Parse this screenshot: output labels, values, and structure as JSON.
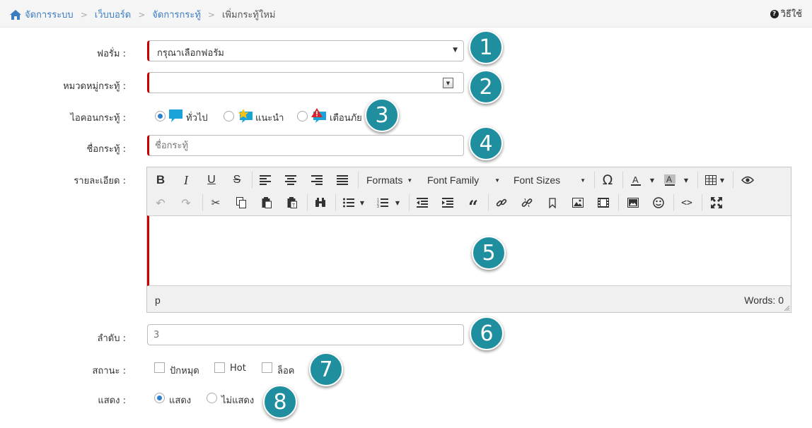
{
  "breadcrumb": {
    "items": [
      "จัดการระบบ",
      "เว็บบอร์ด",
      "จัดการกระทู้"
    ],
    "current": "เพิ่มกระทู้ใหม่"
  },
  "help": {
    "label": "วิธีใช้"
  },
  "form": {
    "forum_label": "ฟอรั่ม :",
    "forum_value": "กรุณาเลือกฟอรัม",
    "category_label": "หมวดหมู่กระทู้ :",
    "category_value": "",
    "icon_label": "ไอคอนกระทู้ :",
    "icon_options": [
      {
        "label": "ทั่วไป",
        "checked": true
      },
      {
        "label": "แนะนำ",
        "checked": false
      },
      {
        "label": "เตือนภัย",
        "checked": false
      }
    ],
    "title_label": "ชื่อกระทู้ :",
    "title_placeholder": "ชื่อกระทู้",
    "detail_label": "รายละเอียด :",
    "order_label": "ลำดับ :",
    "order_placeholder": "3",
    "status_label": "สถานะ :",
    "status_options": [
      {
        "label": "ปักหมุด",
        "checked": false
      },
      {
        "label": "Hot",
        "checked": false
      },
      {
        "label": "ล็อค",
        "checked": false
      }
    ],
    "show_label": "แสดง :",
    "show_options": [
      {
        "label": "แสดง",
        "checked": true
      },
      {
        "label": "ไม่แสดง",
        "checked": false
      }
    ]
  },
  "editor": {
    "menus": {
      "formats": "Formats",
      "font_family": "Font Family",
      "font_sizes": "Font Sizes"
    },
    "path": "p",
    "word_count": "Words: 0"
  },
  "callouts": [
    "1",
    "2",
    "3",
    "4",
    "5",
    "6",
    "7",
    "8"
  ],
  "colors": {
    "accent": "#2b7fd1",
    "required": "#cc0000",
    "callout": "#1f8fa0",
    "link": "#3a7cc2"
  }
}
